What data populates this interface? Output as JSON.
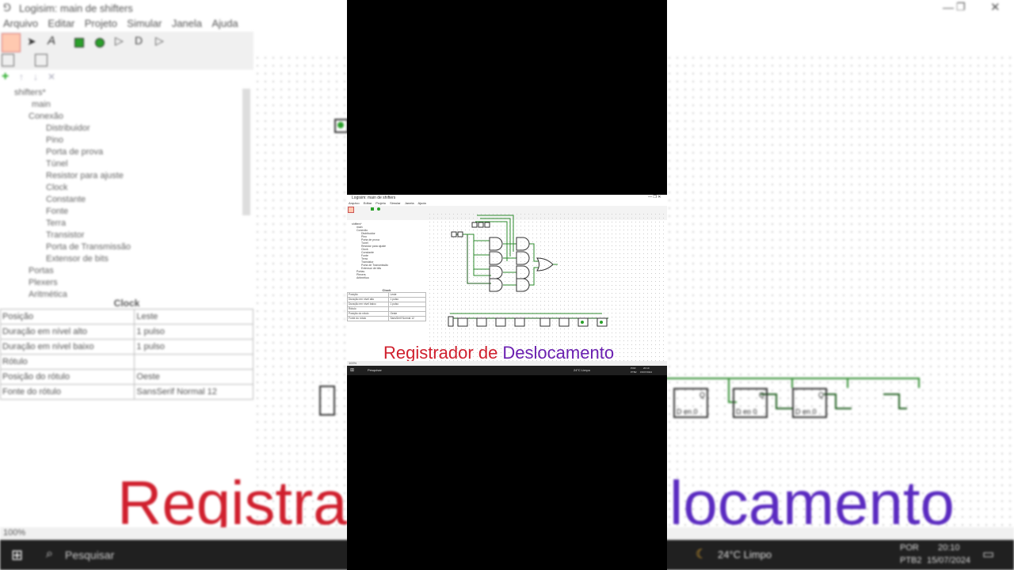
{
  "window": {
    "title": "Logisim: main de shifters"
  },
  "menu": [
    "Arquivo",
    "Editar",
    "Projeto",
    "Simular",
    "Janela",
    "Ajuda"
  ],
  "tree": {
    "project": "shifters*",
    "items": [
      "main",
      "Conexão",
      "Distribuidor",
      "Pino",
      "Porta de prova",
      "Túnel",
      "Resistor para ajuste",
      "Clock",
      "Constante",
      "Fonte",
      "Terra",
      "Transistor",
      "Porta de Transmissão",
      "Extensor de bits",
      "Portas",
      "Plexers",
      "Aritmética"
    ]
  },
  "props": {
    "title": "Clock",
    "rows": [
      {
        "k": "Posição",
        "v": "Leste"
      },
      {
        "k": "Duração em nível alto",
        "v": "1 pulso"
      },
      {
        "k": "Duração em nível baixo",
        "v": "1 pulso"
      },
      {
        "k": "Rótulo",
        "v": ""
      },
      {
        "k": "Posição do rótulo",
        "v": "Oeste"
      },
      {
        "k": "Fonte do rótulo",
        "v": "SansSerif Normal 12"
      }
    ]
  },
  "status": {
    "zoom": "100%"
  },
  "taskbar": {
    "search": "Pesquisar",
    "weather": "24°C Limpo",
    "lang1": "POR",
    "lang2": "PTB2",
    "time": "20:10",
    "date": "15/07/2024"
  },
  "overlay": {
    "title_part1": "Registrador de ",
    "title_part2": "Deslocamento",
    "bg_title_left": "Registra",
    "bg_title_right": "locamento"
  },
  "canvas": {
    "ff_label": "D en 0",
    "ff_out": "Q"
  },
  "colors": {
    "red": "#d0202e",
    "purple": "#6a1fb0",
    "wire_green": "#2e8b2e",
    "wire_dark": "#1a5a1a"
  }
}
